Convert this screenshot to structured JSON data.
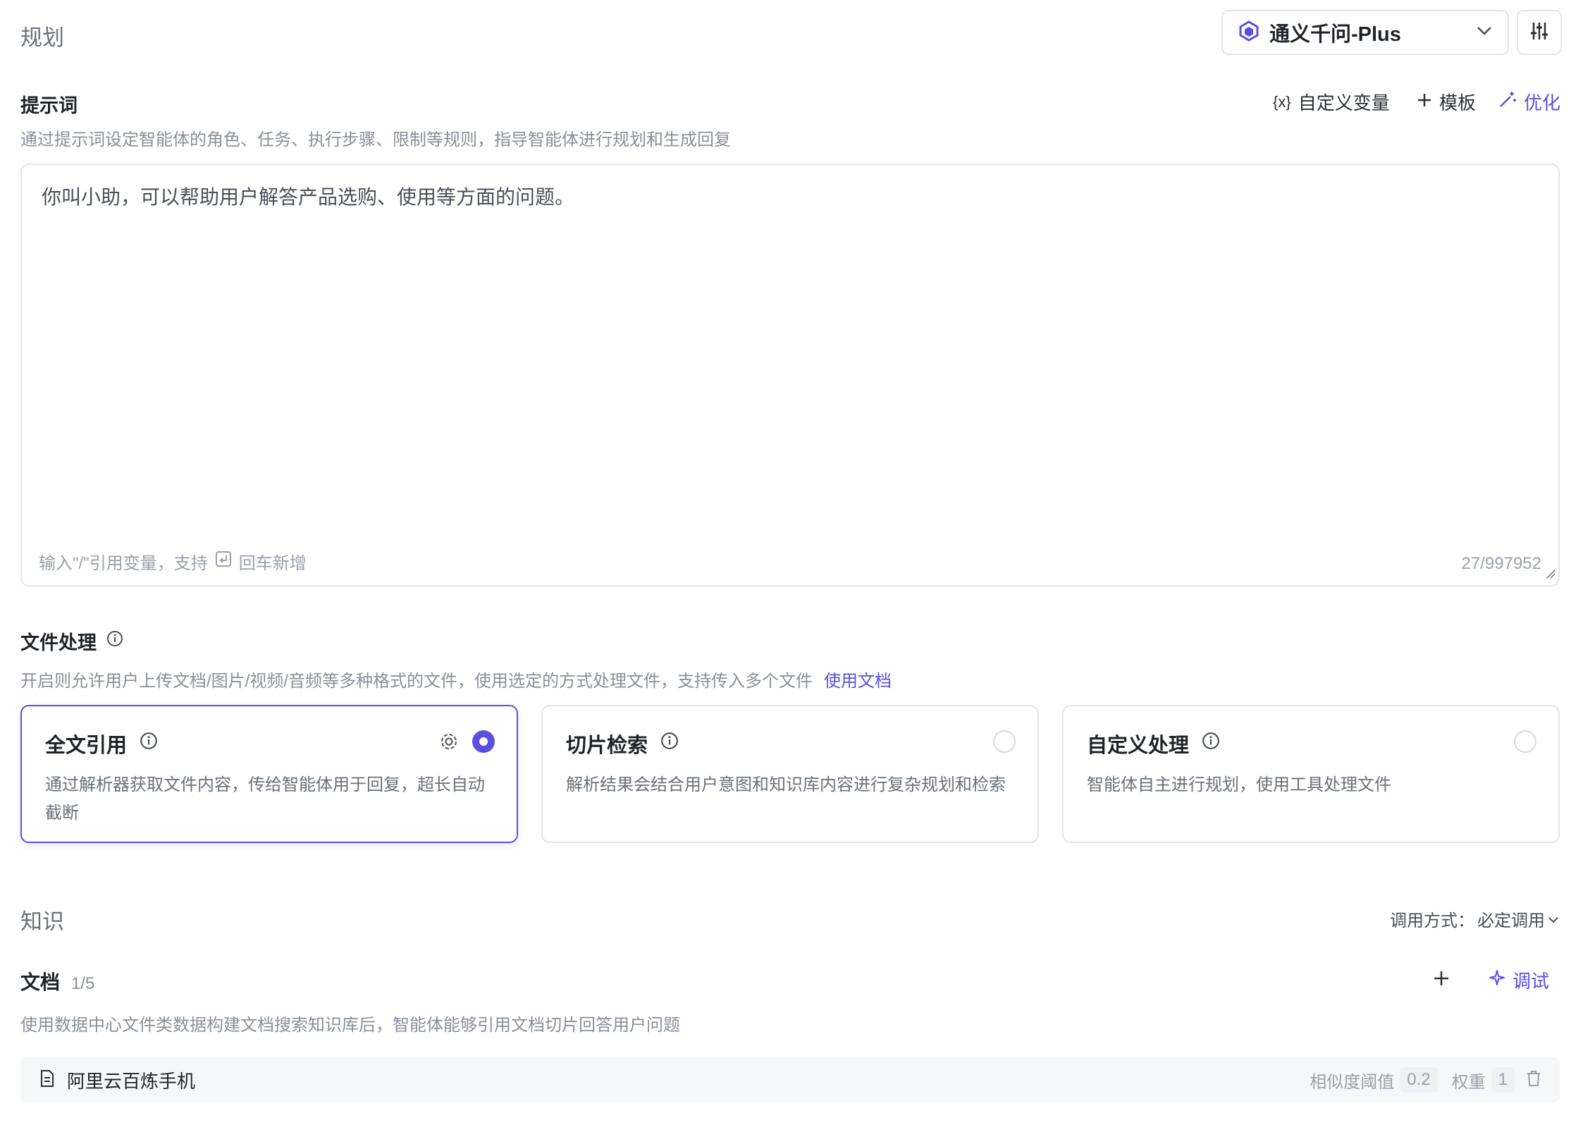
{
  "header": {
    "title": "规划",
    "model_name": "通义千问-Plus"
  },
  "prompt": {
    "label": "提示词",
    "description": "通过提示词设定智能体的角色、任务、执行步骤、限制等规则，指导智能体进行规划和生成回复",
    "custom_variable": "自定义变量",
    "variable_icon_text": "{x}",
    "template": "模板",
    "optimize": "优化",
    "text": "你叫小助，可以帮助用户解答产品选购、使用等方面的问题。",
    "hint_prefix": "输入\"/\"引用变量，支持",
    "hint_suffix": "回车新增",
    "count": "27/997952"
  },
  "file_processing": {
    "label": "文件处理",
    "description": "开启则允许用户上传文档/图片/视频/音频等多种格式的文件，使用选定的方式处理文件，支持传入多个文件",
    "docs_link": "使用文档",
    "options": [
      {
        "title": "全文引用",
        "body": "通过解析器获取文件内容，传给智能体用于回复，超长自动截断",
        "selected": true
      },
      {
        "title": "切片检索",
        "body": "解析结果会结合用户意图和知识库内容进行复杂规划和检索",
        "selected": false
      },
      {
        "title": "自定义处理",
        "body": "智能体自主进行规划，使用工具处理文件",
        "selected": false
      }
    ]
  },
  "knowledge": {
    "title": "知识",
    "call_mode_label": "调用方式：",
    "call_mode_value": "必定调用"
  },
  "documents": {
    "label": "文档",
    "count": "1/5",
    "debug": "调试",
    "description": "使用数据中心文件类数据构建文档搜索知识库后，智能体能够引用文档切片回答用户问题",
    "items": [
      {
        "name": "阿里云百炼手机",
        "similarity_label": "相似度阈值",
        "similarity_value": "0.2",
        "weight_label": "权重",
        "weight_value": "1"
      }
    ]
  },
  "colors": {
    "accent": "#5b4fe0",
    "border": "#e3e5ea",
    "muted": "#8a8f99"
  }
}
